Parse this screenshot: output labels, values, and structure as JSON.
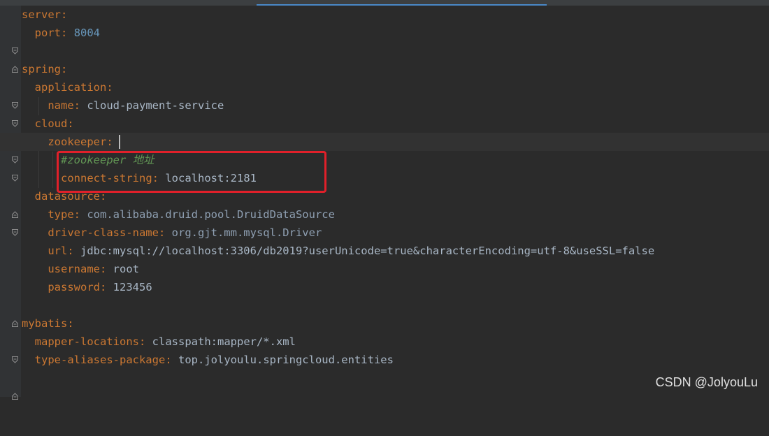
{
  "editor": {
    "lines": [
      {
        "key": "server",
        "colon": ":",
        "value": ""
      },
      {
        "key": "port",
        "colon": ":",
        "value": "8004"
      },
      {
        "key": "",
        "colon": "",
        "value": ""
      },
      {
        "key": "spring",
        "colon": ":",
        "value": ""
      },
      {
        "key": "application",
        "colon": ":",
        "value": ""
      },
      {
        "key": "name",
        "colon": ":",
        "value": "cloud-payment-service"
      },
      {
        "key": "cloud",
        "colon": ":",
        "value": ""
      },
      {
        "key": "zookeeper",
        "colon": ":",
        "value": ""
      },
      {
        "key": "",
        "colon": "",
        "value": "",
        "comment": "#zookeeper 地址"
      },
      {
        "key": "connect-string",
        "colon": ":",
        "value": "localhost:2181"
      },
      {
        "key": "datasource",
        "colon": ":",
        "value": ""
      },
      {
        "key": "type",
        "colon": ":",
        "value": "com.alibaba.druid.pool.DruidDataSource"
      },
      {
        "key": "driver-class-name",
        "colon": ":",
        "value": "org.gjt.mm.mysql.Driver"
      },
      {
        "key": "url",
        "colon": ":",
        "value": "jdbc:mysql://localhost:3306/db2019?userUnicode=true&characterEncoding=utf-8&useSSL=false"
      },
      {
        "key": "username",
        "colon": ":",
        "value": "root"
      },
      {
        "key": "password",
        "colon": ":",
        "value": "123456"
      },
      {
        "key": "",
        "colon": "",
        "value": ""
      },
      {
        "key": "mybatis",
        "colon": ":",
        "value": ""
      },
      {
        "key": "mapper-locations",
        "colon": ":",
        "value": "classpath:mapper/*.xml"
      },
      {
        "key": "type-aliases-package",
        "colon": ":",
        "value": "top.jolyoulu.springcloud.entities"
      }
    ],
    "current_line": 8
  },
  "colors": {
    "background": "#2b2b2b",
    "key": "#cc7832",
    "number": "#6897bb",
    "comment": "#629755",
    "highlight_box": "#e0202a"
  },
  "watermark": "CSDN @JolyouLu"
}
